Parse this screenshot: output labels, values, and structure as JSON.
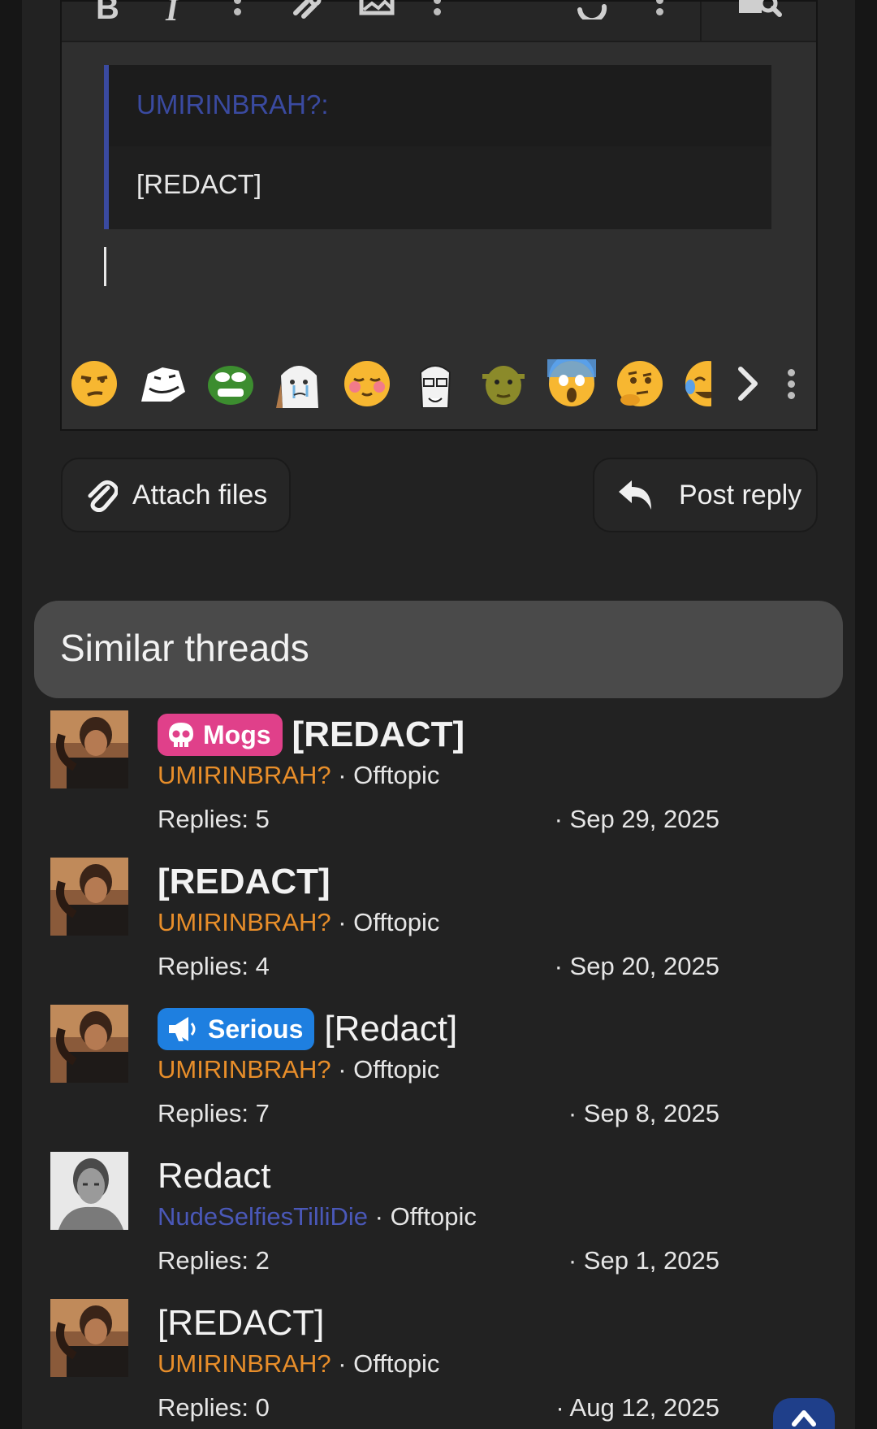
{
  "editor": {
    "quote_author": "UMIRINBRAH?:",
    "quote_text": "[REDACT]"
  },
  "buttons": {
    "attach": "Attach files",
    "post_reply": "Post reply"
  },
  "similar": {
    "heading": "Similar threads",
    "threads": [
      {
        "prefix": "Mogs",
        "title": "[REDACT]",
        "author": "UMIRINBRAH?",
        "forum": "Offtopic",
        "replies": "Replies: 5",
        "date": "Sep 29, 2025"
      },
      {
        "prefix": "",
        "title": "[REDACT]",
        "author": "UMIRINBRAH?",
        "forum": "Offtopic",
        "replies": "Replies: 4",
        "date": "Sep 20, 2025"
      },
      {
        "prefix": "Serious",
        "title": "[Redact]",
        "author": "UMIRINBRAH?",
        "forum": "Offtopic",
        "replies": "Replies: 7",
        "date": "Sep 8, 2025"
      },
      {
        "prefix": "",
        "title": "Redact",
        "author": "NudeSelfiesTilliDie",
        "forum": "Offtopic",
        "replies": "Replies: 2",
        "date": "Sep 1, 2025"
      },
      {
        "prefix": "",
        "title": "[REDACT]",
        "author": "UMIRINBRAH?",
        "forum": "Offtopic",
        "replies": "Replies: 0",
        "date": "Aug 12, 2025"
      }
    ]
  },
  "colors": {
    "prefix_mogs": "#e0408a",
    "prefix_serious": "#1e7fe0",
    "author_orange": "#e88e2a",
    "author_blue": "#4a58b8"
  }
}
